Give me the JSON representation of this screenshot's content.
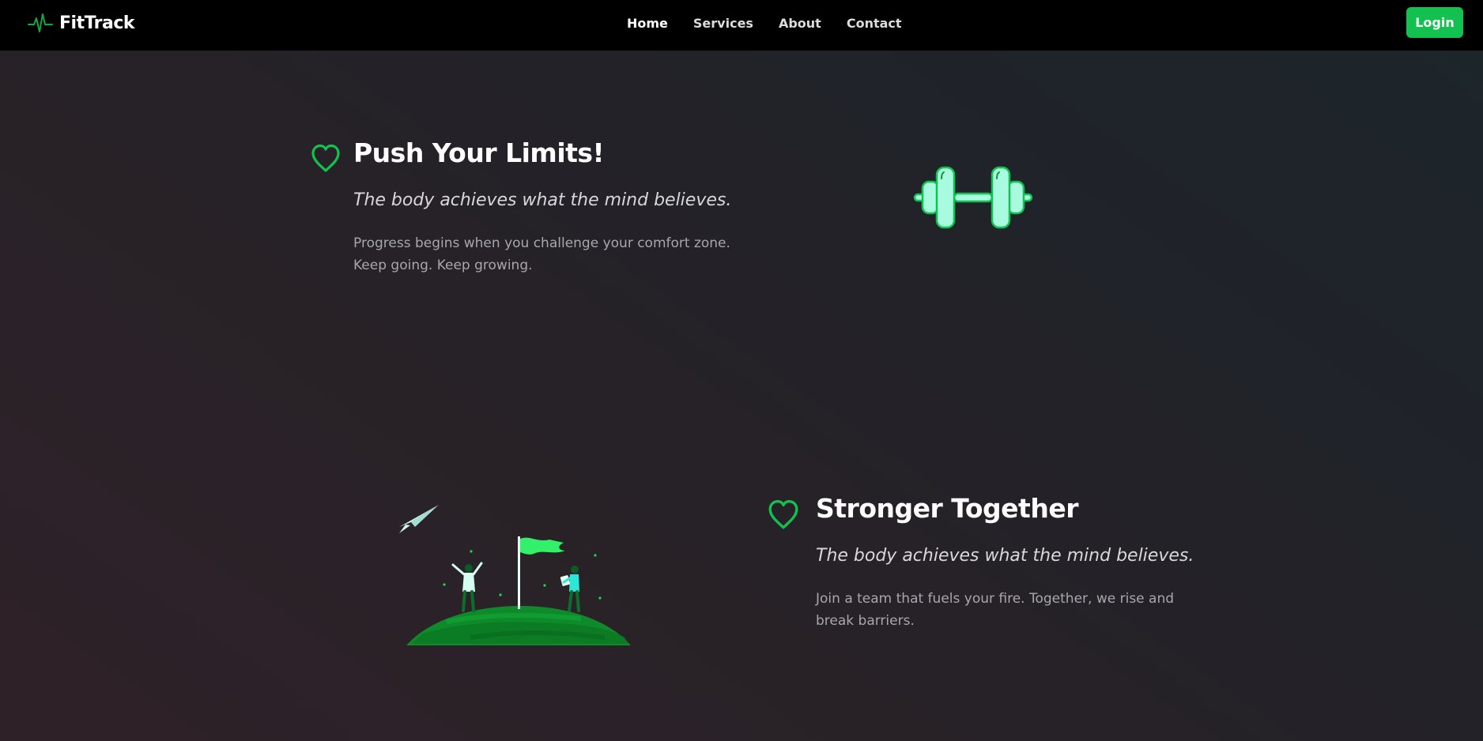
{
  "brand": {
    "name": "FitTrack",
    "icon": "pulse-icon"
  },
  "nav": {
    "items": [
      {
        "label": "Home",
        "active": true
      },
      {
        "label": "Services",
        "active": false
      },
      {
        "label": "About",
        "active": false
      },
      {
        "label": "Contact",
        "active": false
      }
    ],
    "login_label": "Login"
  },
  "sections": [
    {
      "icon": "heart-icon",
      "title": "Push Your Limits!",
      "quote": "The body achieves what the mind believes.",
      "body_line1": "Progress begins when you challenge your comfort zone.",
      "body_line2": "Keep going. Keep growing.",
      "illustration": "dumbbell-icon"
    },
    {
      "icon": "heart-icon",
      "title": "Stronger Together",
      "quote": "The body achieves what the mind believes.",
      "body_line1": "Join a team that fuels your fire. Together, we rise and",
      "body_line2": "break barriers.",
      "illustration": "summit-flag-illustration"
    }
  ],
  "colors": {
    "accent": "#12c14f",
    "navbar_bg": "#000000",
    "page_bg_from": "#2f2128",
    "page_bg_to": "#1c262a",
    "mint": "#a9fbe0"
  }
}
